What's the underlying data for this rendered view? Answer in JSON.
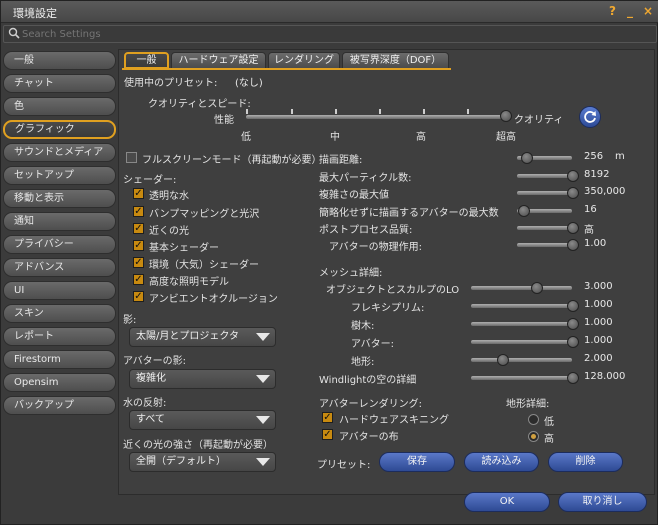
{
  "window": {
    "title": "環境設定",
    "help": "?",
    "minimize": "_",
    "close": "×"
  },
  "search": {
    "placeholder": "Search Settings"
  },
  "sidebar": {
    "items": [
      {
        "label": "一般"
      },
      {
        "label": "チャット"
      },
      {
        "label": "色"
      },
      {
        "label": "グラフィック"
      },
      {
        "label": "サウンドとメディア"
      },
      {
        "label": "セットアップ"
      },
      {
        "label": "移動と表示"
      },
      {
        "label": "通知"
      },
      {
        "label": "プライバシー"
      },
      {
        "label": "アドバンス"
      },
      {
        "label": "UI"
      },
      {
        "label": "スキン"
      },
      {
        "label": "レポート"
      },
      {
        "label": "Firestorm"
      },
      {
        "label": "Opensim"
      },
      {
        "label": "バックアップ"
      }
    ],
    "active_index": 3
  },
  "tabs": [
    {
      "label": "一般"
    },
    {
      "label": "ハードウェア設定"
    },
    {
      "label": "レンダリング"
    },
    {
      "label": "被写界深度（DOF）"
    }
  ],
  "preset_in_use": {
    "label": "使用中のプリセット:",
    "value": "(なし)"
  },
  "quality": {
    "label": "クオリティとスピード:",
    "left_label": "性能",
    "right_label": "クオリティ",
    "ticks": [
      "低",
      "中",
      "高",
      "超高"
    ],
    "level_fraction": 1.0
  },
  "fullscreen": {
    "label": "フルスクリーンモード（再起動が必要）",
    "checked": false
  },
  "shaders": {
    "label": "シェーダー:",
    "items": [
      {
        "label": "透明な水",
        "checked": true
      },
      {
        "label": "バンプマッピングと光沢",
        "checked": true
      },
      {
        "label": "近くの光",
        "checked": true
      },
      {
        "label": "基本シェーダー",
        "checked": true
      },
      {
        "label": "環境（大気）シェーダー",
        "checked": true
      },
      {
        "label": "高度な照明モデル",
        "checked": true
      },
      {
        "label": "アンビエントオクルージョン",
        "checked": true
      }
    ]
  },
  "shadows": {
    "label": "影:",
    "value": "太陽/月とプロジェクタ"
  },
  "avatar_shadows": {
    "label": "アバターの影:",
    "value": "複雑化"
  },
  "water_reflection": {
    "label": "水の反射:",
    "value": "すべて"
  },
  "near_light": {
    "label": "近くの光の強さ（再起動が必要）",
    "value": "全開（デフォルト）"
  },
  "right_sliders": [
    {
      "label": "描画距離:",
      "value": "256",
      "unit": "m",
      "fraction": 0.1
    },
    {
      "label": "最大パーティクル数:",
      "value": "8192",
      "unit": "",
      "fraction": 1.0
    },
    {
      "label": "複雑さの最大値",
      "value": "350,000",
      "unit": "",
      "fraction": 1.0
    },
    {
      "label": "簡略化せずに描画するアバターの最大数",
      "value": "16",
      "unit": "",
      "fraction": 0.15
    },
    {
      "label": "ポストプロセス品質:",
      "value": "高",
      "unit": "",
      "fraction": 1.0
    },
    {
      "label": "アバターの物理作用:",
      "value": "1.00",
      "unit": "",
      "fraction": 1.0
    }
  ],
  "mesh_detail": {
    "label": "メッシュ詳細:",
    "items": [
      {
        "label": "オブジェクトとスカルプのLO",
        "value": "3.000",
        "fraction": 0.6
      },
      {
        "label": "フレキシプリム:",
        "value": "1.000",
        "fraction": 1.0
      },
      {
        "label": "樹木:",
        "value": "1.000",
        "fraction": 1.0
      },
      {
        "label": "アバター:",
        "value": "1.000",
        "fraction": 1.0
      },
      {
        "label": "地形:",
        "value": "2.000",
        "fraction": 0.3
      }
    ]
  },
  "windlight": {
    "label": "Windlightの空の詳細",
    "value": "128.000",
    "fraction": 1.0
  },
  "avatar_render": {
    "label": "アバターレンダリング:",
    "items": [
      {
        "label": "ハードウェアスキニング",
        "checked": true
      },
      {
        "label": "アバターの布",
        "checked": true
      }
    ]
  },
  "terrain_detail": {
    "label": "地形詳細:",
    "options": [
      {
        "label": "低",
        "selected": false
      },
      {
        "label": "高",
        "selected": true
      }
    ]
  },
  "presets": {
    "label": "プリセット:",
    "save": "保存",
    "load": "読み込み",
    "delete": "削除"
  },
  "footer": {
    "ok": "OK",
    "cancel": "取り消し"
  },
  "colors": {
    "accent": "#e0a020",
    "button": "#3a5cb0"
  }
}
